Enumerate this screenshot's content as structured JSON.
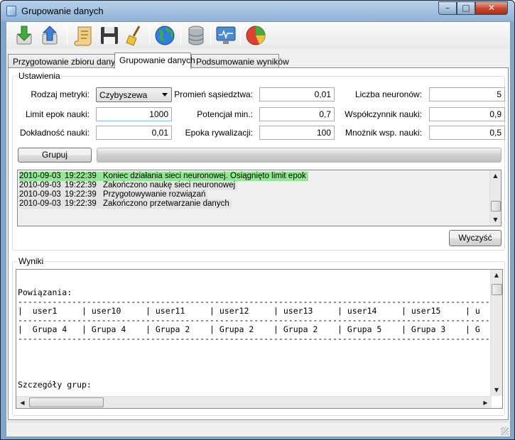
{
  "window": {
    "title": "Grupowanie danych",
    "minimize_glyph": "–",
    "maximize_glyph": "□",
    "close_glyph": "✕"
  },
  "toolbar": {
    "buttons": [
      {
        "icon": "import-icon"
      },
      {
        "icon": "export-icon"
      },
      {
        "icon": "scroll-icon"
      },
      {
        "icon": "save-icon"
      },
      {
        "icon": "broom-icon"
      },
      {
        "icon": "globe-icon"
      },
      {
        "icon": "database-icon"
      },
      {
        "icon": "monitor-icon"
      },
      {
        "icon": "pie-chart-icon"
      }
    ]
  },
  "tabs": [
    {
      "label": "Przygotowanie zbioru danych"
    },
    {
      "label": "Grupowanie danych"
    },
    {
      "label": "Podsumowanie wyników"
    }
  ],
  "settings": {
    "title": "Ustawienia",
    "metric_label": "Rodzaj metryki:",
    "metric_value": "Czybyszewa",
    "neighborhood_label": "Promień sąsiedztwa:",
    "neighborhood_value": "0,01",
    "neurons_label": "Liczba neuronów:",
    "neurons_value": "5",
    "epoch_limit_label": "Limit epok nauki:",
    "epoch_limit_value": "1000",
    "potential_label": "Potencjał min.:",
    "potential_value": "0,7",
    "learning_rate_label": "Współczynnik nauki:",
    "learning_rate_value": "0,9",
    "accuracy_label": "Dokładność nauki:",
    "accuracy_value": "0,01",
    "competition_label": "Epoka rywalizacji:",
    "competition_value": "100",
    "multiplier_label": "Mnożnik wsp. nauki:",
    "multiplier_value": "0,5",
    "group_button": "Grupuj",
    "clear_button": "Wyczyść"
  },
  "log": [
    {
      "date": "2010-09-03",
      "time": "19:22:39",
      "message": "Koniec działania sieci neuronowej. Osiągnięto limit epok",
      "highlight": "#90e890"
    },
    {
      "date": "2010-09-03",
      "time": "19:22:39",
      "message": "Zakończono naukę sieci neuronowej",
      "highlight": "#e4e4e4"
    },
    {
      "date": "2010-09-03",
      "time": "19:22:39",
      "message": "Przygotowywanie rozwiązań",
      "highlight": "#e4e4e4"
    },
    {
      "date": "2010-09-03",
      "time": "19:22:39",
      "message": "Zakończono przetwarzanie danych",
      "highlight": "#e4e4e4"
    }
  ],
  "results": {
    "title": "Wyniki",
    "lines": [
      "",
      "",
      "Powiązania:",
      "--------------------------------------------------------------------------------------------------------",
      "|  user1     | user10     | user11     | user12     | user13     | user14     | user15     | u",
      "--------------------------------------------------------------------------------------------------------",
      "|  Grupa 4   | Grupa 4    | Grupa 2    | Grupa 2    | Grupa 2    | Grupa 5    | Grupa 3    | G",
      "--------------------------------------------------------------------------------------------------------",
      "",
      "",
      "",
      "",
      "Szczegóły grup:"
    ]
  }
}
